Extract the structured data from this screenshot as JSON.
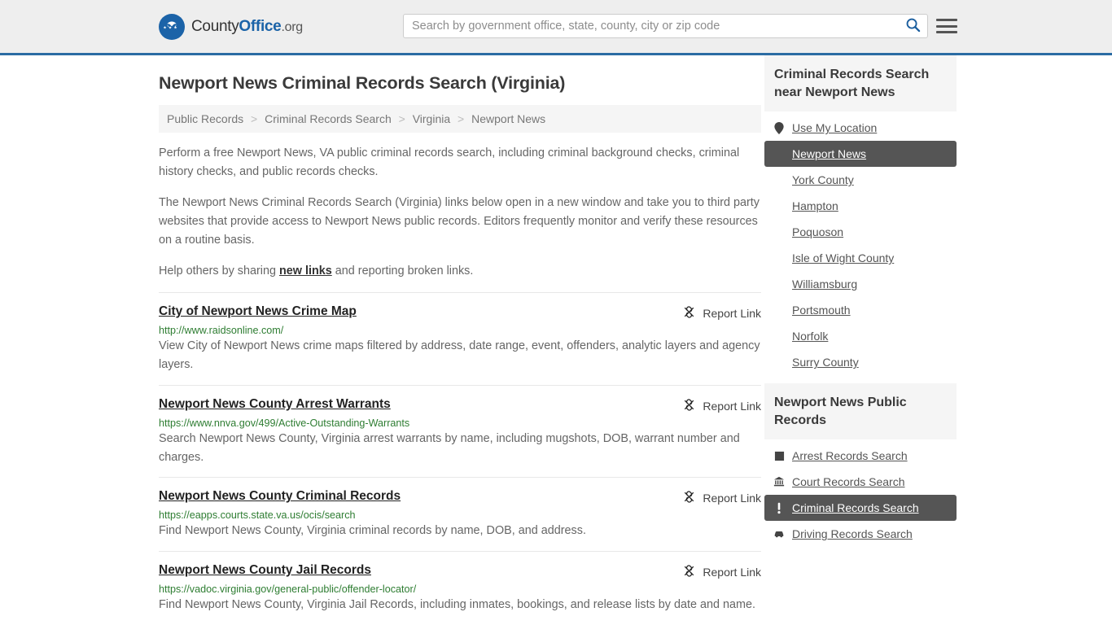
{
  "header": {
    "brand": {
      "part1": "County",
      "part2": "Office",
      "tld": ".org"
    },
    "search": {
      "placeholder": "Search by government office, state, county, city or zip code",
      "value": ""
    },
    "icons": {
      "search": "search-icon",
      "menu": "hamburger-menu-icon"
    },
    "accent_color": "#2b6ca3"
  },
  "page_title": "Newport News Criminal Records Search (Virginia)",
  "breadcrumb": {
    "items": [
      "Public Records",
      "Criminal Records Search",
      "Virginia",
      "Newport News"
    ],
    "separator": ">"
  },
  "intro": {
    "paragraph1": "Perform a free Newport News, VA public criminal records search, including criminal background checks, criminal history checks, and public records checks.",
    "paragraph2": "The Newport News Criminal Records Search (Virginia) links below open in a new window and take you to third party websites that provide access to Newport News public records. Editors frequently monitor and verify these resources on a routine basis.",
    "paragraph3_before": "Help others by sharing ",
    "paragraph3_link": "new links",
    "paragraph3_after": " and reporting broken links."
  },
  "report_link_label": "Report Link",
  "listings": [
    {
      "title": "City of Newport News Crime Map",
      "url": "http://www.raidsonline.com/",
      "description": "View City of Newport News crime maps filtered by address, date range, event, offenders, analytic layers and agency layers."
    },
    {
      "title": "Newport News County Arrest Warrants",
      "url": "https://www.nnva.gov/499/Active-Outstanding-Warrants",
      "description": "Search Newport News County, Virginia arrest warrants by name, including mugshots, DOB, warrant number and charges."
    },
    {
      "title": "Newport News County Criminal Records",
      "url": "https://eapps.courts.state.va.us/ocis/search",
      "description": "Find Newport News County, Virginia criminal records by name, DOB, and address."
    },
    {
      "title": "Newport News County Jail Records",
      "url": "https://vadoc.virginia.gov/general-public/offender-locator/",
      "description": "Find Newport News County, Virginia Jail Records, including inmates, bookings, and release lists by date and name."
    }
  ],
  "sidebar": {
    "nearby_panel": {
      "heading": "Criminal Records Search near Newport News",
      "items": [
        {
          "label": "Use My Location",
          "icon": "map-pin-icon",
          "active": false
        },
        {
          "label": "Newport News",
          "icon": "",
          "active": true
        },
        {
          "label": "York County",
          "icon": "",
          "active": false
        },
        {
          "label": "Hampton",
          "icon": "",
          "active": false
        },
        {
          "label": "Poquoson",
          "icon": "",
          "active": false
        },
        {
          "label": "Isle of Wight County",
          "icon": "",
          "active": false
        },
        {
          "label": "Williamsburg",
          "icon": "",
          "active": false
        },
        {
          "label": "Portsmouth",
          "icon": "",
          "active": false
        },
        {
          "label": "Norfolk",
          "icon": "",
          "active": false
        },
        {
          "label": "Surry County",
          "icon": "",
          "active": false
        }
      ]
    },
    "records_panel": {
      "heading": "Newport News Public Records",
      "items": [
        {
          "label": "Arrest Records Search",
          "icon": "fingerprint-icon",
          "active": false
        },
        {
          "label": "Court Records Search",
          "icon": "courthouse-icon",
          "active": false
        },
        {
          "label": "Criminal Records Search",
          "icon": "exclamation-icon",
          "active": true
        },
        {
          "label": "Driving Records Search",
          "icon": "car-icon",
          "active": false
        }
      ]
    },
    "active_color": "#555555"
  }
}
